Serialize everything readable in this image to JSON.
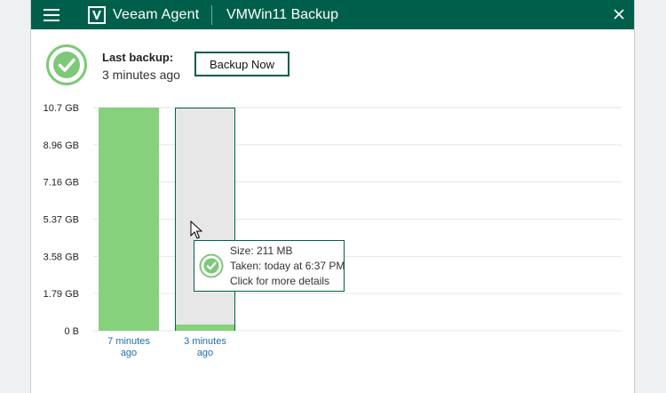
{
  "titlebar": {
    "app_name": "Veeam Agent",
    "window_title": "VMWin11 Backup",
    "icons": {
      "menu": "hamburger-menu-icon",
      "logo": "veeam-logo-icon",
      "close": "close-icon"
    }
  },
  "status": {
    "icon": "check-circle-icon",
    "last_backup_label": "Last backup:",
    "last_backup_value": "3 minutes ago",
    "backup_now_label": "Backup Now"
  },
  "colors": {
    "titlebar": "#005f4b",
    "accent": "#005f4b",
    "success": "#7ec879",
    "bar_green": "#86d17c",
    "bar_selected_bg": "#e8e7e8",
    "category_text": "#1e6fa8",
    "grid": "#e6e6e6"
  },
  "chart_data": {
    "type": "bar",
    "y_tick_labels": [
      "0 B",
      "1.79 GB",
      "3.58 GB",
      "5.37 GB",
      "7.16 GB",
      "8.96 GB",
      "10.7 GB"
    ],
    "ylim": [
      0,
      10.7
    ],
    "y_unit": "GB",
    "categories": [
      {
        "line1": "7 minutes",
        "line2": "ago"
      },
      {
        "line1": "3 minutes",
        "line2": "ago"
      }
    ],
    "values": [
      10.7,
      0.211
    ],
    "selected_index": 1,
    "grid": true
  },
  "tooltip": {
    "size": "Size: 211 MB",
    "taken": "Taken: today at 6:37 PM",
    "details": "Click for more details"
  }
}
